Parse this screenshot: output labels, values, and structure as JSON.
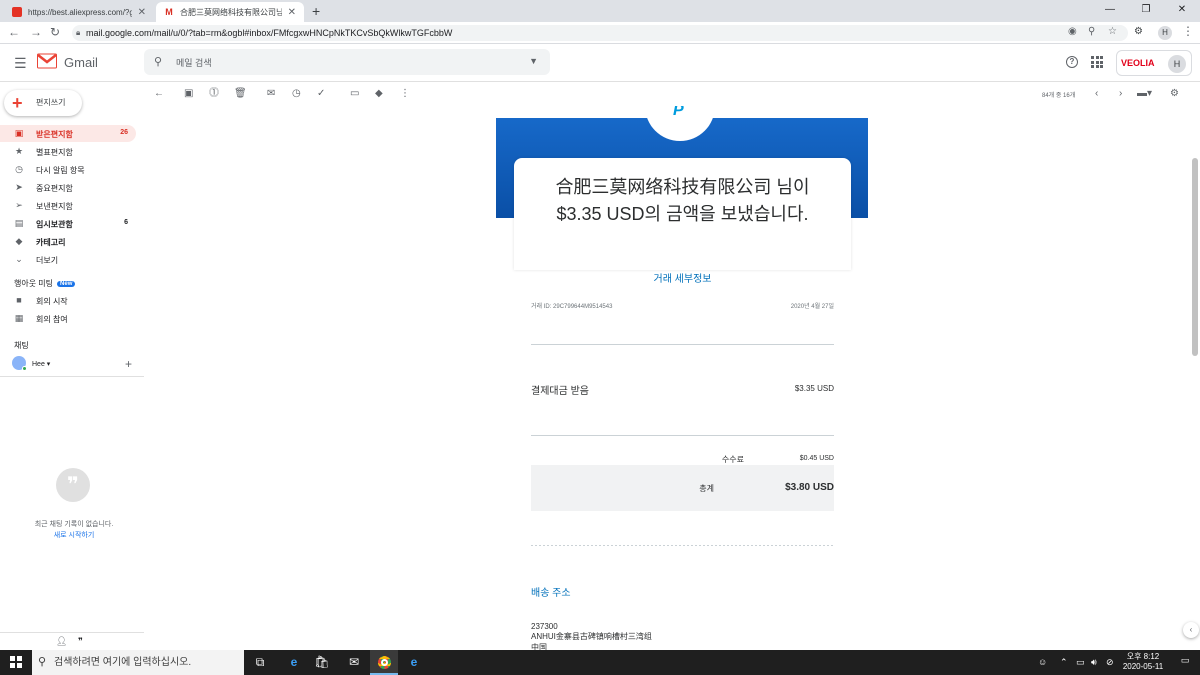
{
  "browser": {
    "tabs": [
      {
        "title": "https://best.aliexpress.com/?gclid",
        "close": "✕"
      },
      {
        "title": "合肥三莫网络科技有限公司님으",
        "close": "✕"
      }
    ],
    "new_tab": "+",
    "window_controls": {
      "minimize": "—",
      "maximize": "❐",
      "close": "✕"
    },
    "url": "mail.google.com/mail/u/0/?tab=rm&ogbl#inbox/FMfcgxwHNCpNkTKCvSbQkWlkwTGFcbbW",
    "profile_initial": "H"
  },
  "gmail": {
    "logo_text": "Gmail",
    "search_placeholder": "메일 검색",
    "account_brand": "VEOLIA",
    "account_initial": "H",
    "compose_label": "편지쓰기",
    "nav": [
      {
        "label": "받은편지함",
        "count": "26",
        "icon": "inbox-icon",
        "glyph": "▣"
      },
      {
        "label": "별표편지함",
        "count": "",
        "icon": "star-icon",
        "glyph": "★"
      },
      {
        "label": "다시 알림 항목",
        "count": "",
        "icon": "snooze-icon",
        "glyph": "◷"
      },
      {
        "label": "중요편지함",
        "count": "",
        "icon": "important-icon",
        "glyph": "➤"
      },
      {
        "label": "보낸편지함",
        "count": "",
        "icon": "sent-icon",
        "glyph": "➢"
      },
      {
        "label": "임시보관함",
        "count": "6",
        "icon": "draft-icon",
        "glyph": "▤"
      },
      {
        "label": "카테고리",
        "count": "",
        "icon": "label-icon",
        "glyph": "◆"
      },
      {
        "label": "더보기",
        "count": "",
        "icon": "chevron-down-icon",
        "glyph": "⌄"
      }
    ],
    "meet": {
      "title": "행아웃 미팅",
      "badge": "New",
      "items": [
        {
          "label": "회의 시작",
          "icon": "video-icon",
          "glyph": "■"
        },
        {
          "label": "회의 참여",
          "icon": "keyboard-icon",
          "glyph": "▦"
        }
      ]
    },
    "chat": {
      "title": "채팅",
      "user": "Hee",
      "empty_text": "최근 채팅 기록이 없습니다.",
      "start_new": "새로 시작하기"
    },
    "pager": "84개 중 16개"
  },
  "email": {
    "headline_line1": "合肥三莫网络科技有限公司 님이",
    "headline_line2": "$3.35 USD의 금액을 보냈습니다.",
    "details_link": "거래 세부정보",
    "transaction_id": "거래 ID: 29C799644M9514543",
    "date": "2020년 4월 27일",
    "payment_label": "결제대금 받음",
    "payment_amount": "$3.35 USD",
    "fee_label": "수수료",
    "fee_amount": "$0.45 USD",
    "total_label": "총계",
    "total_amount": "$3.80 USD",
    "shipping_title": "배송 주소",
    "address_lines": [
      "237300",
      "ANHUI金寨县古碑镇响槽村三湾组",
      "中国"
    ]
  },
  "taskbar": {
    "search_placeholder": "검색하려면 여기에 입력하십시오.",
    "time_period": "오후 8:12",
    "date": "2020-05-11"
  },
  "colors": {
    "gmail_red": "#d93025",
    "paypal_blue": "#0070ba",
    "banner_blue": "#1769c9"
  }
}
